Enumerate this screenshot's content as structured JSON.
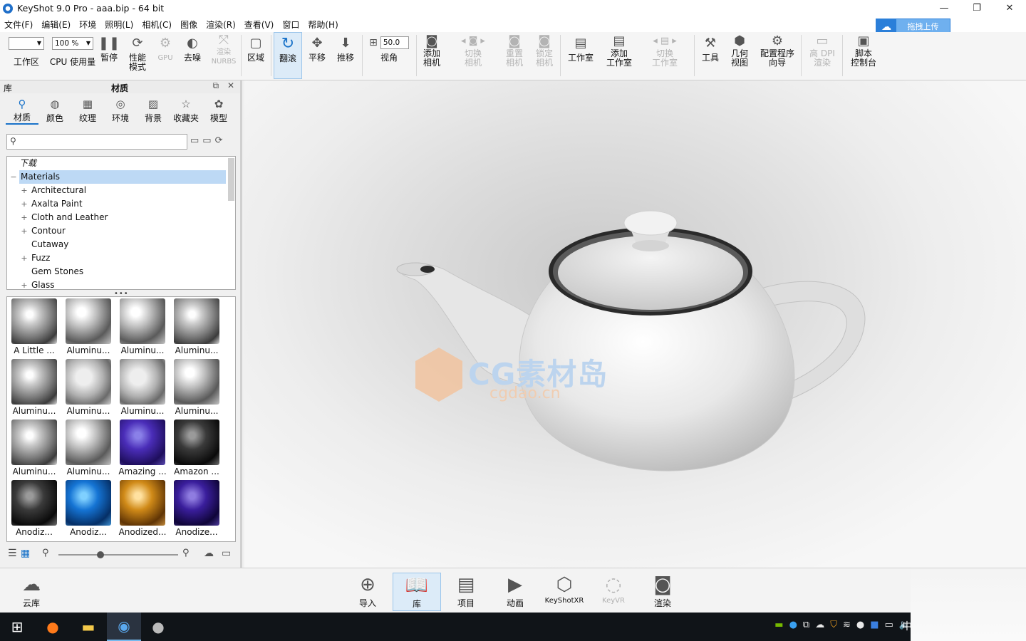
{
  "window": {
    "title": "KeyShot 9.0 Pro  - aaa.bip  - 64 bit",
    "minimize": "—",
    "restore": "❐",
    "close": "✕"
  },
  "menu": [
    "文件(F)",
    "编辑(E)",
    "环境",
    "照明(L)",
    "相机(C)",
    "图像",
    "渲染(R)",
    "查看(V)",
    "窗口",
    "帮助(H)"
  ],
  "cloud_upload": {
    "label": "拖拽上传",
    "icon": "baidu-cloud-icon"
  },
  "ribbon": {
    "workspace_label": "工作区",
    "cpu_value": "100 %",
    "cpu_label": "CPU 使用量",
    "pause": "暂停",
    "performance": "性能\n模式",
    "gpu": "GPU",
    "denoise": "去噪",
    "render_nurbs": "渲染\nNURBS",
    "region": "区域",
    "tumble": "翻滚",
    "pan": "平移",
    "dolly": "推移",
    "fov_value": "50.0",
    "fov_label": "视角",
    "add_camera": "添加\n相机",
    "switch_camera": "切换\n相机",
    "reset_camera": "重置\n相机",
    "lock_camera": "锁定\n相机",
    "studio": "工作室",
    "add_studio": "添加\n工作室",
    "switch_studio": "切换\n工作室",
    "tools": "工具",
    "geometry_view": "几何\n视图",
    "config_wizard": "配置程序\n向导",
    "hidpi_render": "高 DPI\n渲染",
    "script_console": "脚本\n控制台"
  },
  "library": {
    "panel_label": "库",
    "title": "材质",
    "tabs": [
      "材质",
      "颜色",
      "纹理",
      "环境",
      "背景",
      "收藏夹",
      "模型"
    ],
    "search_placeholder": "",
    "tree": [
      {
        "label": "下载",
        "italic": true,
        "expander": ""
      },
      {
        "label": "Materials",
        "selected": true,
        "expander": "−"
      },
      {
        "label": "Architectural",
        "expander": "+"
      },
      {
        "label": "Axalta Paint",
        "expander": "+"
      },
      {
        "label": "Cloth and Leather",
        "expander": "+"
      },
      {
        "label": "Contour",
        "expander": "+"
      },
      {
        "label": "Cutaway",
        "expander": ""
      },
      {
        "label": "Fuzz",
        "expander": "+"
      },
      {
        "label": "Gem Stones",
        "expander": ""
      },
      {
        "label": "Glass",
        "expander": "+"
      }
    ],
    "splitter": "•••",
    "thumbnails": [
      {
        "label": "A Little ...",
        "style": "b-alu"
      },
      {
        "label": "Aluminu...",
        "style": "b-alu2"
      },
      {
        "label": "Aluminu...",
        "style": "b-alu2"
      },
      {
        "label": "Aluminu...",
        "style": "b-alu"
      },
      {
        "label": "Aluminu...",
        "style": "b-alu"
      },
      {
        "label": "Aluminu...",
        "style": "b-hex"
      },
      {
        "label": "Aluminu...",
        "style": "b-hex"
      },
      {
        "label": "Aluminu...",
        "style": "b-alu2"
      },
      {
        "label": "Aluminu...",
        "style": "b-alu"
      },
      {
        "label": "Aluminu...",
        "style": "b-alu2"
      },
      {
        "label": "Amazing ...",
        "style": "b-purple"
      },
      {
        "label": "Amazon ...",
        "style": "b-black"
      },
      {
        "label": "Anodiz...",
        "style": "b-black"
      },
      {
        "label": "Anodiz...",
        "style": "b-blue"
      },
      {
        "label": "Anodized...",
        "style": "b-orange"
      },
      {
        "label": "Anodize...",
        "style": "b-violet"
      }
    ],
    "zoom_fraction": 0.35
  },
  "viewport": {
    "watermark_text": "CG素材岛",
    "watermark_url": "cgdao.cn"
  },
  "dock": {
    "cloud_library": "云库",
    "import": "导入",
    "library": "库",
    "project": "项目",
    "animation": "动画",
    "keyshotxr": "KeyShotXR",
    "keyvr": "KeyVR",
    "render": "渲染"
  },
  "taskbar": {
    "ime": "中"
  },
  "colors": {
    "accent": "#1a73c9",
    "selection": "#bdd9f5",
    "taskbar": "#101418"
  }
}
